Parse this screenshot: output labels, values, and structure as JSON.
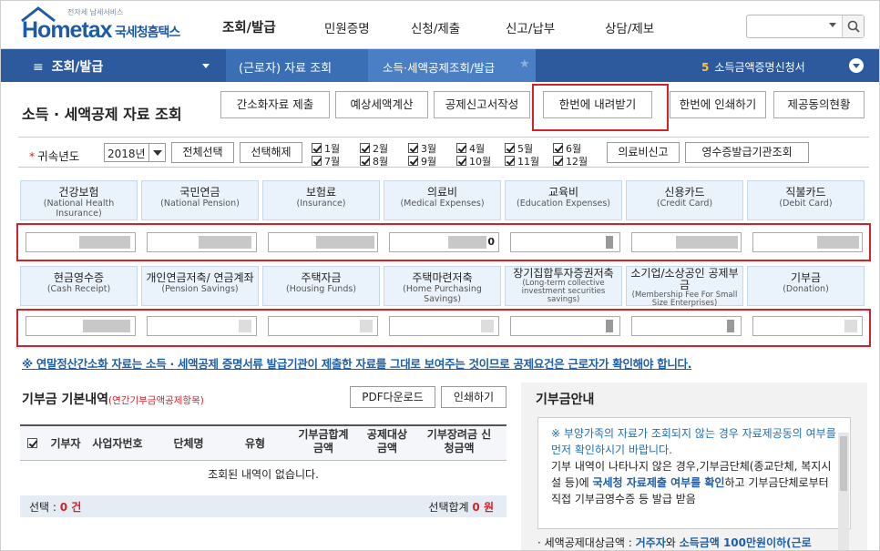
{
  "header": {
    "logo_small": "전자세 납세서비스",
    "logo_brand": "Hometax",
    "logo_kname": "국세청홈택스",
    "gnb": [
      "조회/발급",
      "민원증명",
      "신청/제출",
      "신고/납부",
      "상담/제보"
    ]
  },
  "navbar": {
    "menu": "조회/발급",
    "crumb1": "(근로자) 자료 조회",
    "crumb2": "소득·세액공제조회/발급",
    "crumb3_num": "5",
    "crumb3": "소득금액증명신청서"
  },
  "page_title": "소득 · 세액공제 자료 조회",
  "top_buttons": [
    "간소화자료 제출",
    "예상세액계산",
    "공제신고서작성",
    "한번에 내려받기",
    "한번에 인쇄하기",
    "제공동의현황"
  ],
  "filter": {
    "label": "귀속년도",
    "year": "2018년",
    "select_all": "전체선택",
    "deselect": "선택해제",
    "months": [
      "1월",
      "2월",
      "3월",
      "4월",
      "5월",
      "6월",
      "7월",
      "8월",
      "9월",
      "10월",
      "11월",
      "12월"
    ],
    "btn_medical": "의료비신고",
    "btn_receipt": "영수증발급기관조회"
  },
  "cards_row1": [
    {
      "k": "건강보험",
      "e": "(National Health Insurance)",
      "v": ""
    },
    {
      "k": "국민연금",
      "e": "(National Pension)",
      "v": ""
    },
    {
      "k": "보험료",
      "e": "(Insurance)",
      "v": ""
    },
    {
      "k": "의료비",
      "e": "(Medical Expenses)",
      "v": "0"
    },
    {
      "k": "교육비",
      "e": "(Education Expenses)",
      "v": ""
    },
    {
      "k": "신용카드",
      "e": "(Credit Card)",
      "v": ""
    },
    {
      "k": "직불카드",
      "e": "(Debit Card)",
      "v": ""
    }
  ],
  "cards_row2": [
    {
      "k": "현금영수증",
      "e": "(Cash Receipt)"
    },
    {
      "k": "개인연금저축/ 연금계좌",
      "e": "(Pension Savings)"
    },
    {
      "k": "주택자금",
      "e": "(Housing Funds)"
    },
    {
      "k": "주택마련저축",
      "e": "(Home Purchasing Savings)"
    },
    {
      "k": "장기집합투자증권저축",
      "e": "(Long-term collective investment securities savings)"
    },
    {
      "k": "소기업/소상공인 공제부금",
      "e": "(Membership Fee For Small Size Enterprises)"
    },
    {
      "k": "기부금",
      "e": "(Donation)"
    }
  ],
  "notice": "※ 연말정산간소화 자료는 소득 · 세액공제 증명서류 발급기관이 제출한 자료를 그대로 보여주는 것이므로 공제요건은 근로자가 확인해야 합니다.",
  "donation": {
    "title": "기부금 기본내역",
    "subtitle": "(연간기부금액공제항목)",
    "pdf_btn": "PDF다운로드",
    "print_btn": "인쇄하기",
    "columns": [
      "기부자",
      "사업자번호",
      "단체명",
      "유형",
      "기부금합계 금액",
      "공제대상 금액",
      "기부장려금 신청금액"
    ],
    "empty": "조회된 내역이 없습니다.",
    "selection_label": "선택 :",
    "selection_value": "0 건",
    "sum_label": "선택합계",
    "sum_value": "0 원"
  },
  "guide": {
    "title": "기부금안내",
    "note": "※ 부양가족의 자료가 조회되지 않는 경우 자료제공동의 여부를 먼저 확인하시기 바랍니다.",
    "line_a": "기부 내역이 나타나지 않은 경우,기부금단체(종교단체, 복지시설 등)에 ",
    "line_hl": "국세청 자료제출 여부를 확인",
    "line_b": "하고 기부금단체로부터 직접 기부금영수증 등 발급 받음",
    "last_a": "· 세액공제대상금액 : ",
    "last_hl1": "거주자",
    "last_mid": "와 ",
    "last_hl2": "소득금액 100만원이하(근로"
  }
}
